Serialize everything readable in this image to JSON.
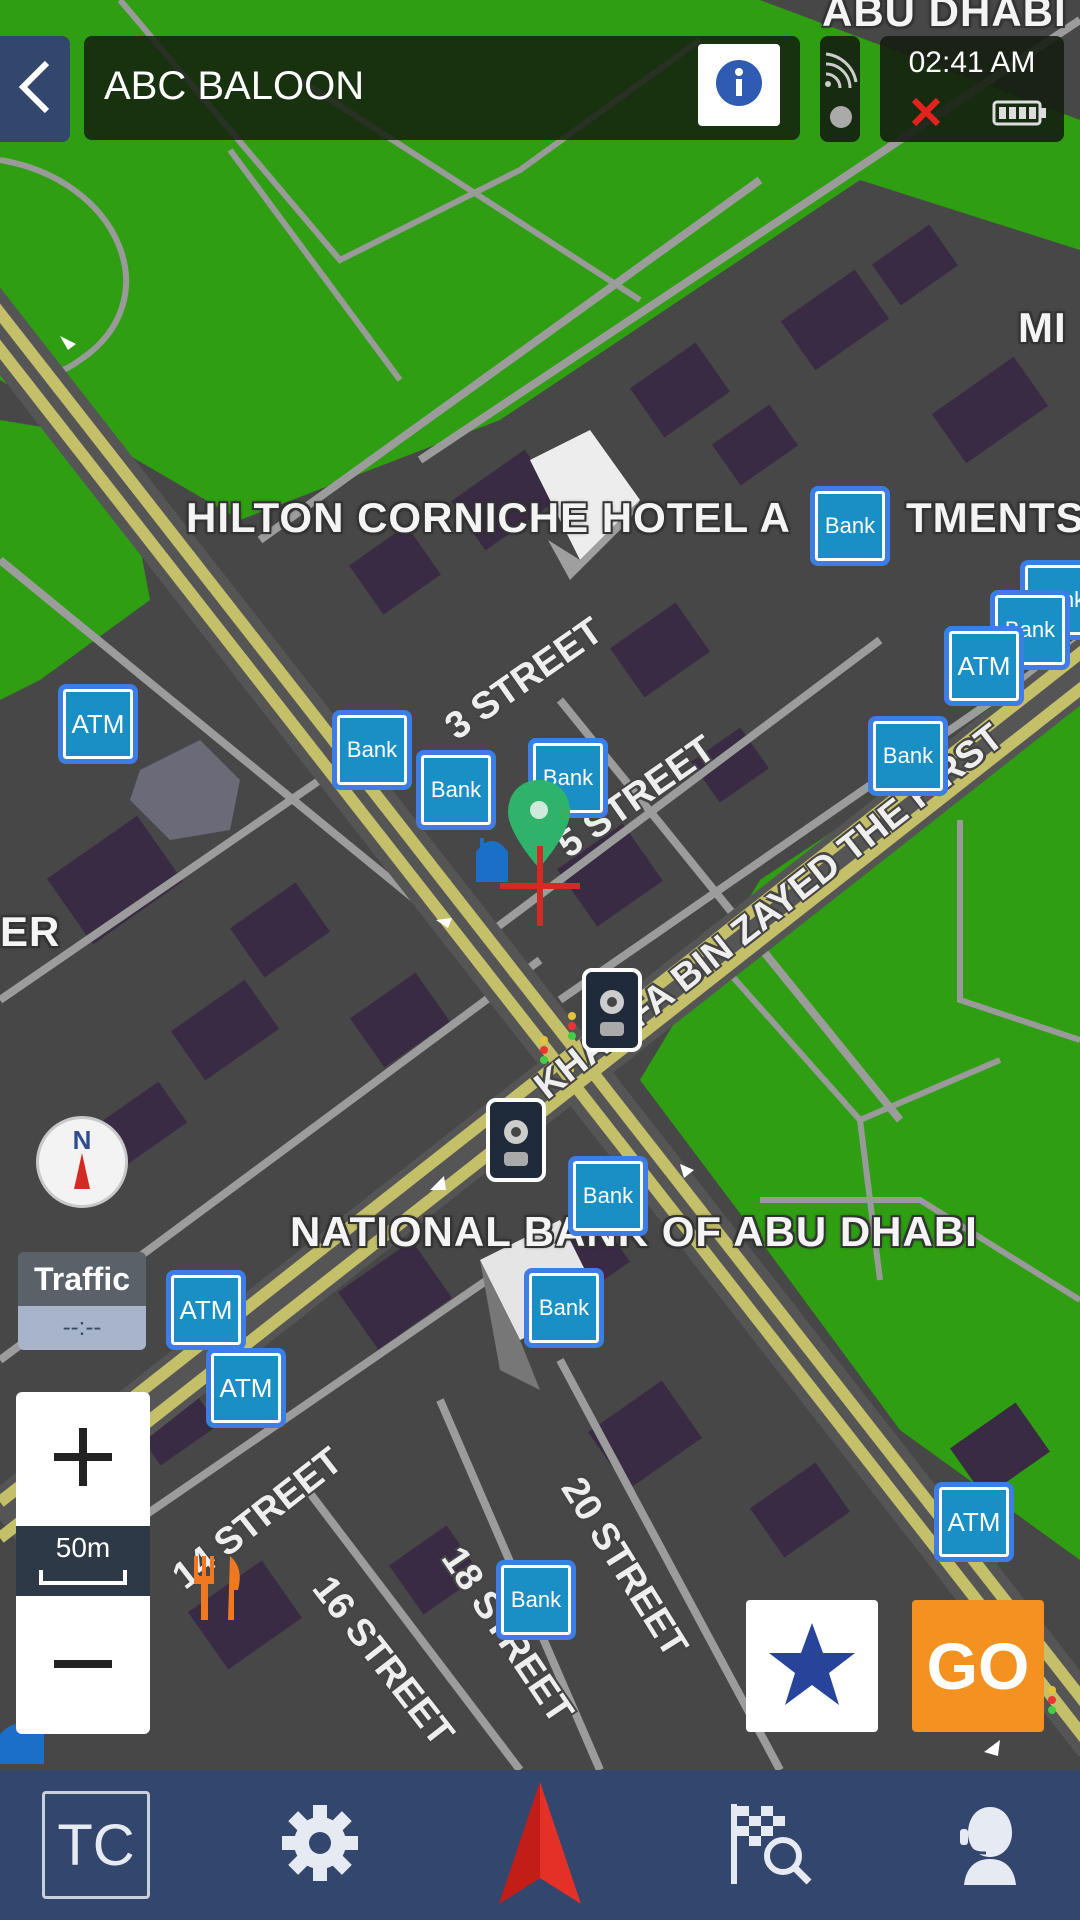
{
  "header": {
    "title": "ABC BALOON",
    "time": "02:41 AM"
  },
  "map": {
    "labels": {
      "hilton": "HILTON CORNICHE HOTEL A",
      "hilton_tail": "TMENTS",
      "national_bank": "NATIONAL BANK OF ABU DHABI",
      "abu_dhabi_top": "ABU DHABI",
      "mi": "MI",
      "er": "ER"
    },
    "streets": {
      "street3": "3 STREET",
      "street5": "5 STREET",
      "khalifa": "KHALIFA BIN ZAYED THE FIRST",
      "street14": "14 STREET",
      "street16": "16 STREET",
      "street18": "18 STREET",
      "street20": "20 STREET"
    },
    "pois": {
      "bank_label": "Bank",
      "atm_label": "ATM"
    }
  },
  "traffic": {
    "title": "Traffic",
    "value": "--:--"
  },
  "zoom": {
    "scale": "50m"
  },
  "buttons": {
    "go": "GO"
  },
  "bottom_nav": {
    "tc": "TC"
  },
  "colors": {
    "park": "#2f9e12",
    "road": "#4a4a4a",
    "main_road": "#c4c06a",
    "building": "#3a2b44",
    "poi_blue": "#1a8fc6",
    "nav_bar": "#33466e",
    "go_orange": "#f39220",
    "arrow_red": "#e53027"
  },
  "icons": {
    "back": "chevron-left-icon",
    "info": "info-icon",
    "gps": "gps-signal-icon",
    "gps_off": "gps-off-icon",
    "battery": "battery-icon",
    "compass": "compass-icon",
    "zoom_in": "plus-icon",
    "zoom_out": "minus-icon",
    "favorite": "star-icon",
    "settings": "gear-icon",
    "navigate": "navigation-arrow-icon",
    "search_destination": "flag-search-icon",
    "support": "headset-support-icon"
  }
}
